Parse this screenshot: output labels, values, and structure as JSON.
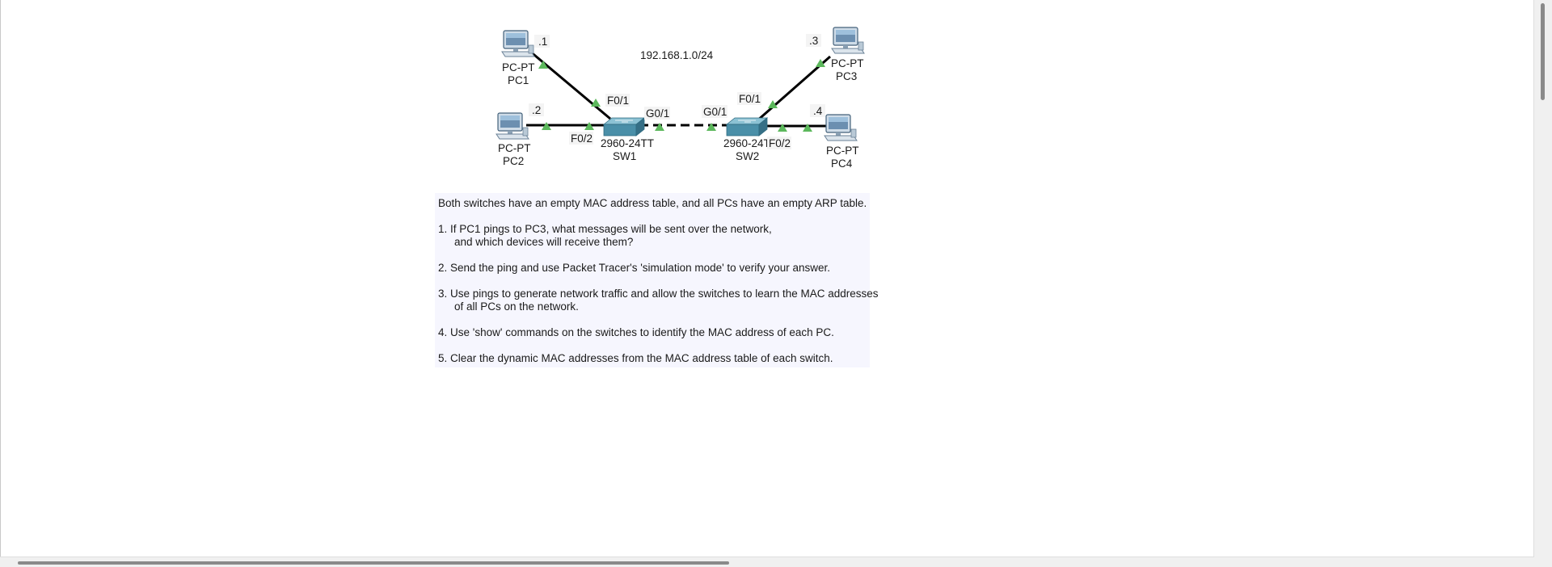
{
  "topology": {
    "subnet_label": "192.168.1.0/24",
    "devices": {
      "pc1": {
        "type": "PC-PT",
        "name": "PC1",
        "ip_suffix": ".1"
      },
      "pc2": {
        "type": "PC-PT",
        "name": "PC2",
        "ip_suffix": ".2"
      },
      "pc3": {
        "type": "PC-PT",
        "name": "PC3",
        "ip_suffix": ".3"
      },
      "pc4": {
        "type": "PC-PT",
        "name": "PC4",
        "ip_suffix": ".4"
      },
      "sw1": {
        "type": "2960-24TT",
        "name": "SW1"
      },
      "sw2": {
        "type": "2960-24T",
        "name": "SW2"
      }
    },
    "ports": {
      "sw1_f01": "F0/1",
      "sw1_f02": "F0/2",
      "sw1_g01": "G0/1",
      "sw2_g01": "G0/1",
      "sw2_f01": "F0/1",
      "sw2_f02": "F0/2"
    },
    "colors": {
      "link": "#000000",
      "link_up_indicator": "#5cb85c",
      "switch_body": "#4a8fa8",
      "pc_body": "#9fb6c8"
    }
  },
  "note": {
    "intro": "Both switches have an empty MAC address table, and all PCs have an empty ARP table.",
    "tasks": [
      {
        "line1": "1. If PC1 pings to PC3, what messages will be sent over the network,",
        "line2": "and which devices will receive them?"
      },
      {
        "line1": "2. Send the ping and use Packet Tracer's 'simulation mode' to verify your answer.",
        "line2": ""
      },
      {
        "line1": "3. Use pings to generate network traffic and allow the switches to learn the MAC addresses",
        "line2": "of all PCs on the network."
      },
      {
        "line1": "4. Use 'show' commands on the switches to identify the MAC address of each PC.",
        "line2": ""
      },
      {
        "line1": "5. Clear the dynamic MAC addresses from the MAC address table of each switch.",
        "line2": ""
      }
    ]
  }
}
